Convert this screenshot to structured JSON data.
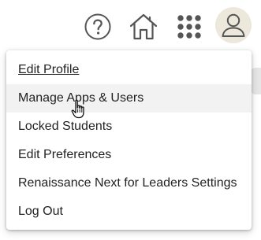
{
  "header": {
    "help_icon": "help-circle-icon",
    "home_icon": "home-icon",
    "apps_icon": "apps-grid-icon",
    "avatar_icon": "user-icon",
    "avatar_bg": "#ede8dc"
  },
  "user_menu": {
    "items": [
      {
        "label": "Edit Profile",
        "state": "focused"
      },
      {
        "label": "Manage Apps & Users",
        "state": "hover"
      },
      {
        "label": "Locked Students",
        "state": "normal"
      },
      {
        "label": "Edit Preferences",
        "state": "normal"
      },
      {
        "label": "Renaissance Next for Leaders Settings",
        "state": "normal"
      },
      {
        "label": "Log Out",
        "state": "normal"
      }
    ]
  },
  "colors": {
    "icon": "#555555",
    "text": "#222222",
    "hover_bg": "#f2f2f2"
  }
}
